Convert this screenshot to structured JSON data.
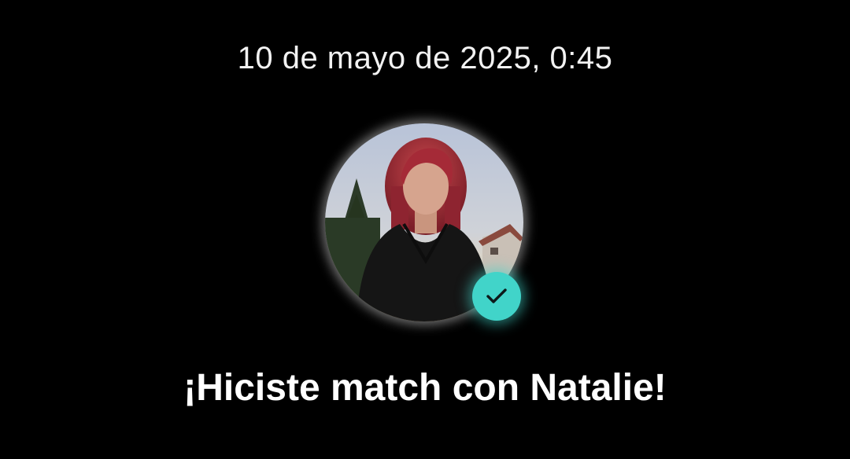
{
  "match": {
    "timestamp": "10 de mayo de 2025, 0:45",
    "headline": "¡Hiciste match con Natalie!",
    "avatar_icon": "profile-photo",
    "badge_icon": "checkmark-icon",
    "colors": {
      "background": "#000000",
      "text": "#ffffff",
      "badge": "#41d4c9"
    }
  }
}
